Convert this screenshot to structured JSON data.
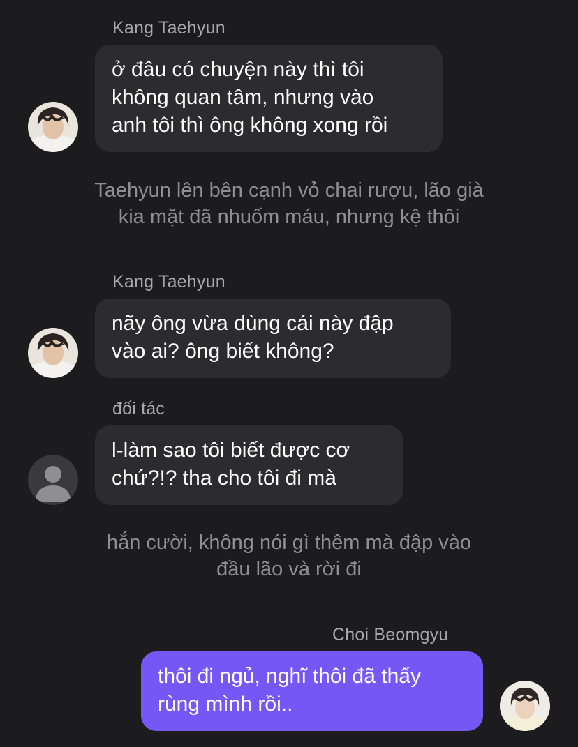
{
  "chat": {
    "messages": [
      {
        "sender": "Kang Taehyun",
        "lines": [
          "ở đâu có chuyện này thì tôi",
          "không quan tâm, nhưng vào",
          "anh tôi thì ông không xong rồi"
        ]
      },
      {
        "narration": [
          "Taehyun lên bên cạnh vỏ chai rượu, lão già",
          "kia mặt đã nhuốm máu, nhưng kệ thôi"
        ]
      },
      {
        "sender": "Kang Taehyun",
        "lines": [
          "nãy ông vừa dùng cái này đập",
          "vào ai? ông biết không?"
        ]
      },
      {
        "sender": "đối tác",
        "lines": [
          "l-làm sao tôi biết được cơ",
          "chứ?!? tha cho tôi đi mà"
        ]
      },
      {
        "narration": [
          "hắn cười, không nói gì thêm mà đập vào",
          "đầu lão và rời đi"
        ]
      },
      {
        "sender": "Choi Beomgyu",
        "lines": [
          "thôi đi ngủ, nghĩ thôi đã thấy",
          "rùng mình rồi.."
        ]
      }
    ]
  },
  "colors": {
    "background": "#1c1c1e",
    "bubble_other": "#2c2c2e",
    "bubble_mine": "#7458f6",
    "sender_name": "#a9a9ad",
    "narration_text": "#8e8e93"
  },
  "icons": {
    "taehyun_avatar": "person-photo-avatar",
    "partner_avatar": "default-person-icon",
    "beomgyu_avatar": "person-photo-avatar"
  }
}
